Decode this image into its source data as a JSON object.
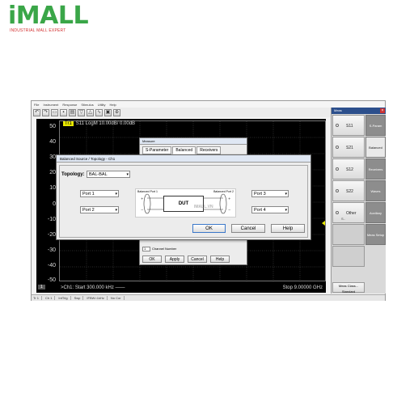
{
  "logo": {
    "text": "iMALL",
    "subtitle": "INDUSTRIAL MALL EXPERT"
  },
  "menu": [
    "File",
    "Instrument",
    "Response",
    "Stimulus",
    "Utility",
    "Help"
  ],
  "toolbar_icons": [
    "undo-icon",
    "redo-icon",
    "open-icon",
    "save-icon",
    "print-icon",
    "marker-icon",
    "scale-icon",
    "trace-icon",
    "window-icon",
    "zoom-icon"
  ],
  "graph": {
    "trace_badge": "Tr1",
    "trace_title": "S11 LogM 10.00dB/ 0.00dB",
    "y_ticks": [
      "50",
      "40",
      "30",
      "20",
      "10",
      "0",
      "-10",
      "-20",
      "-30",
      "-40",
      "-50"
    ],
    "channel": "1",
    "start": ">Ch1: Start 300.000 kHz ——",
    "stop": "Stop 9.00000 GHz"
  },
  "statusbar": [
    "Tr 1",
    "Ch 1",
    "IntTrig",
    "Swp",
    "IFBW=1kHz",
    "No Cor"
  ],
  "panel": {
    "title": "Meas",
    "softkeys": [
      {
        "label": "S11"
      },
      {
        "label": "S21"
      },
      {
        "label": "S12"
      },
      {
        "label": "S22"
      },
      {
        "label": "Other",
        "sub": "S.."
      }
    ],
    "tabs": [
      "S-Param",
      "Balanced",
      "Receivers",
      "Waves",
      "Auxiliary",
      "Meas Setup"
    ],
    "meas_class": "Meas Class...",
    "meas_class_sub": "Standard"
  },
  "measure_dialog": {
    "title": "Measure",
    "tabs": [
      "S-Parameter",
      "Balanced",
      "Receivers"
    ],
    "channel_value": "1",
    "channel_label": "Channel Number",
    "buttons": [
      "OK",
      "Apply",
      "Cancel",
      "Help"
    ]
  },
  "topology_dialog": {
    "title": "Balanced Source / Topology - Ch1",
    "topology_label": "Topology:",
    "topology_value": "BAL-BAL",
    "ports_left": [
      "Port 1",
      "Port 2"
    ],
    "ports_right": [
      "Port 3",
      "Port 4"
    ],
    "balanced_port_1": "Balanced Port 1",
    "balanced_port_2": "Balanced Port 2",
    "dut": "DUT",
    "watermark": "IMALL.VN",
    "ok": "OK",
    "cancel": "Cancel",
    "help": "Help"
  }
}
